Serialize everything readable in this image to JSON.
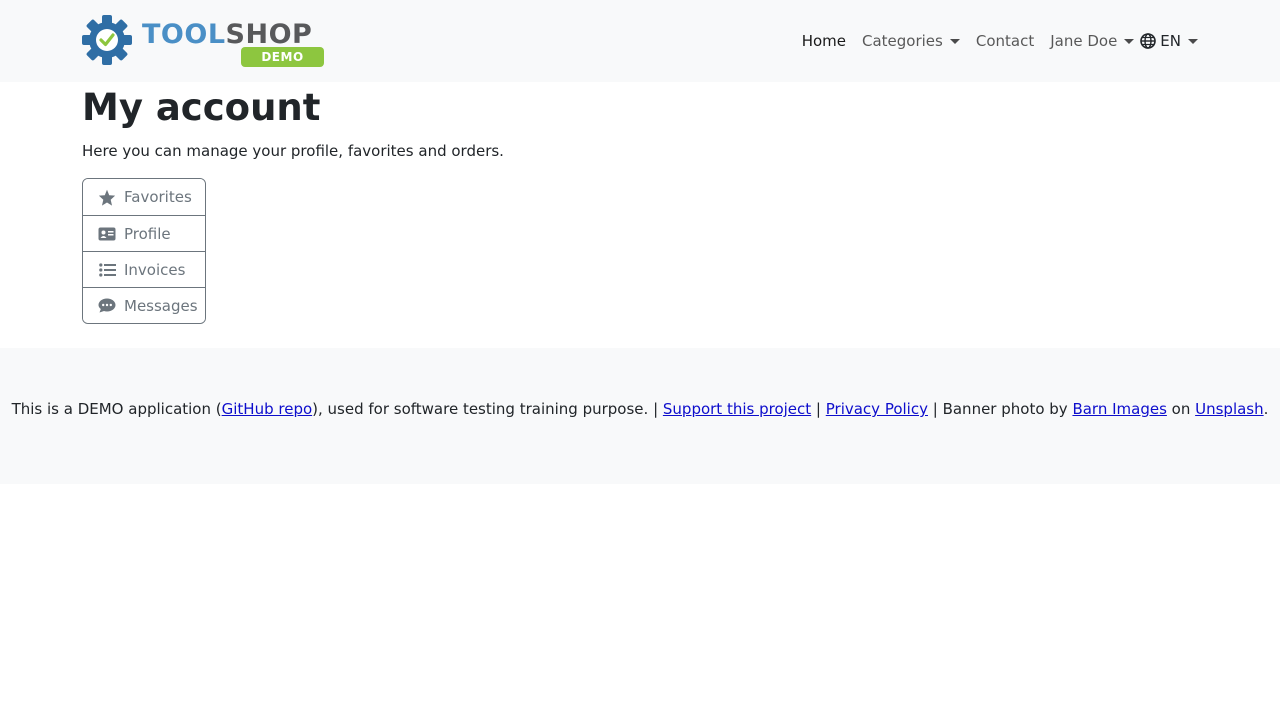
{
  "brand": {
    "word_tool": "TOOL",
    "word_shop": "SHOP",
    "badge": "DEMO",
    "colors": {
      "gear": "#2f6ea5",
      "check": "#8dc63f",
      "tool": "#4a8fc6",
      "shop": "#58595b",
      "badge": "#8dc63f"
    }
  },
  "nav": {
    "home": "Home",
    "categories": "Categories",
    "contact": "Contact",
    "user": "Jane Doe",
    "language": "EN",
    "language_icon": "globe-icon"
  },
  "page": {
    "title": "My account",
    "subtitle": "Here you can manage your profile, favorites and orders."
  },
  "account_menu": [
    {
      "label": "Favorites",
      "icon": "star-icon"
    },
    {
      "label": "Profile",
      "icon": "id-card-icon"
    },
    {
      "label": "Invoices",
      "icon": "list-icon"
    },
    {
      "label": "Messages",
      "icon": "comment-icon"
    }
  ],
  "footer": {
    "part1": "This is a DEMO application (",
    "github_link": "GitHub repo",
    "part2": "), used for software testing training purpose. | ",
    "support_link": "Support this project",
    "sep1": " | ",
    "privacy_link": "Privacy Policy",
    "part3": " | Banner photo by ",
    "barn_link": "Barn Images",
    "part4": " on ",
    "unsplash_link": "Unsplash",
    "part5": "."
  }
}
